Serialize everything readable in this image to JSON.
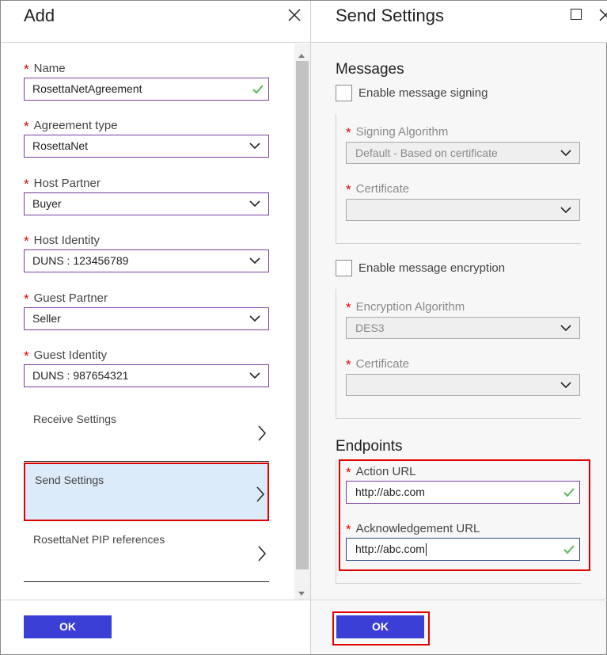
{
  "add_blade": {
    "title": "Add",
    "fields": [
      {
        "label": "Name",
        "value": "RosettaNetAgreement",
        "valid": true
      },
      {
        "label": "Agreement type",
        "value": "RosettaNet"
      },
      {
        "label": "Host Partner",
        "value": "Buyer"
      },
      {
        "label": "Host Identity",
        "value": "DUNS : 123456789"
      },
      {
        "label": "Guest Partner",
        "value": "Seller"
      },
      {
        "label": "Guest Identity",
        "value": "DUNS : 987654321"
      }
    ],
    "nav_items": [
      {
        "label": "Receive Settings",
        "selected": false
      },
      {
        "label": "Send Settings",
        "selected": true
      },
      {
        "label": "RosettaNet PIP references",
        "selected": false
      }
    ],
    "ok_label": "OK"
  },
  "send_blade": {
    "title": "Send Settings",
    "messages": {
      "title": "Messages",
      "signing": {
        "checkbox_label": "Enable message signing",
        "checked": false,
        "algorithm_label": "Signing Algorithm",
        "algorithm_value": "Default - Based on certificate",
        "certificate_label": "Certificate",
        "certificate_value": ""
      },
      "encryption": {
        "checkbox_label": "Enable message encryption",
        "checked": false,
        "algorithm_label": "Encryption Algorithm",
        "algorithm_value": "DES3",
        "certificate_label": "Certificate",
        "certificate_value": ""
      }
    },
    "endpoints": {
      "title": "Endpoints",
      "action_url_label": "Action URL",
      "action_url_value": "http://abc.com",
      "ack_url_label": "Acknowledgement URL",
      "ack_url_value": "http://abc.com"
    },
    "ok_label": "OK"
  },
  "colors": {
    "accent": "#3b3fd6",
    "required": "#e00000",
    "valid": "#5cb85c",
    "selected_bg": "#dcebf9",
    "field_border": "#7b3fa0"
  }
}
